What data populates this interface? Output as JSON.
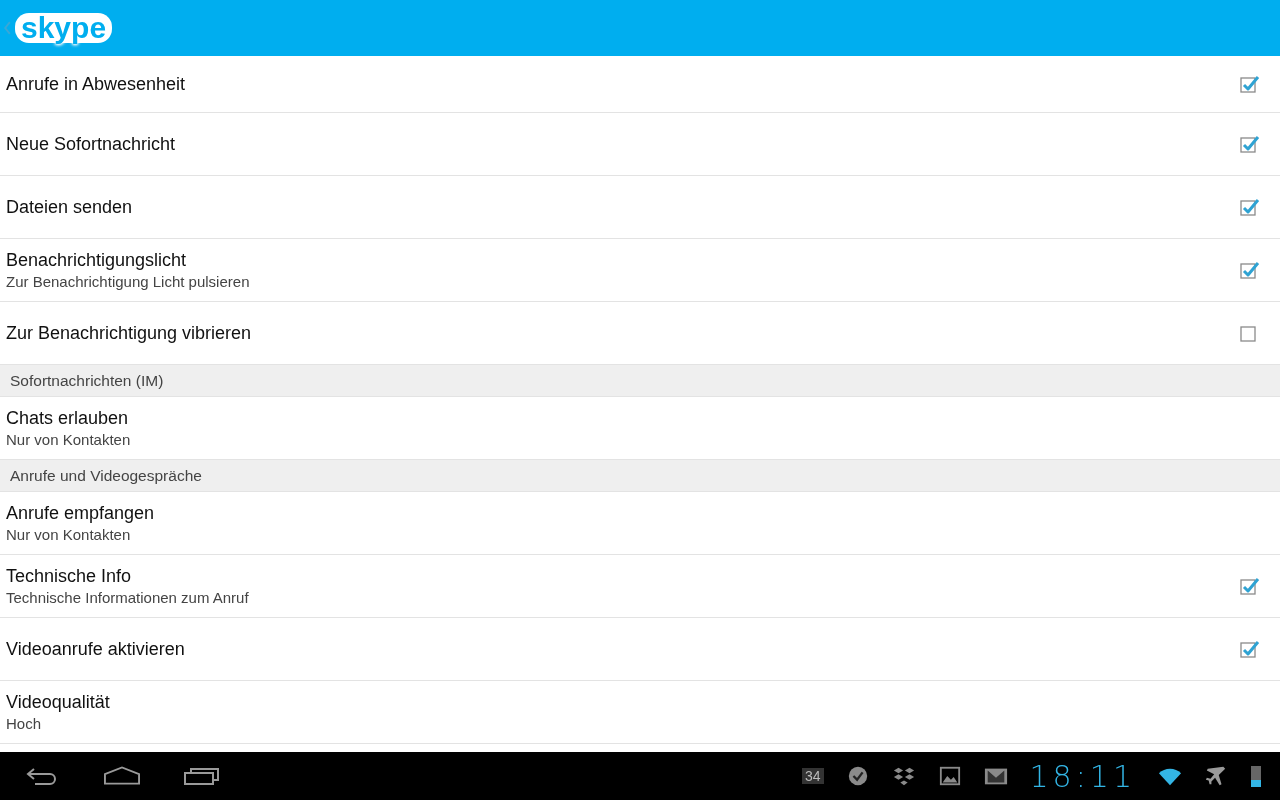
{
  "app_bar": {
    "logo": "skype"
  },
  "items": [
    {
      "kind": "check",
      "title": "Anrufe in Abwesenheit",
      "checked": true
    },
    {
      "kind": "check",
      "title": "Neue Sofortnachricht",
      "checked": true
    },
    {
      "kind": "check",
      "title": "Dateien senden",
      "checked": true
    },
    {
      "kind": "check",
      "title": "Benachrichtigungslicht",
      "subtitle": "Zur Benachrichtigung Licht pulsieren",
      "checked": true
    },
    {
      "kind": "check",
      "title": "Zur Benachrichtigung vibrieren",
      "checked": false
    },
    {
      "kind": "section",
      "title": "Sofortnachrichten (IM)"
    },
    {
      "kind": "detail",
      "title": "Chats erlauben",
      "subtitle": "Nur von Kontakten"
    },
    {
      "kind": "section",
      "title": "Anrufe und Videogespräche"
    },
    {
      "kind": "detail",
      "title": "Anrufe empfangen",
      "subtitle": "Nur von Kontakten"
    },
    {
      "kind": "check",
      "title": "Technische Info",
      "subtitle": "Technische Informationen zum Anruf",
      "checked": true
    },
    {
      "kind": "check",
      "title": "Videoanrufe aktivieren",
      "checked": true
    },
    {
      "kind": "detail",
      "title": "Videoqualität",
      "subtitle": "Hoch"
    }
  ],
  "system_bar": {
    "calendar_day": "34",
    "clock": "18:11"
  }
}
